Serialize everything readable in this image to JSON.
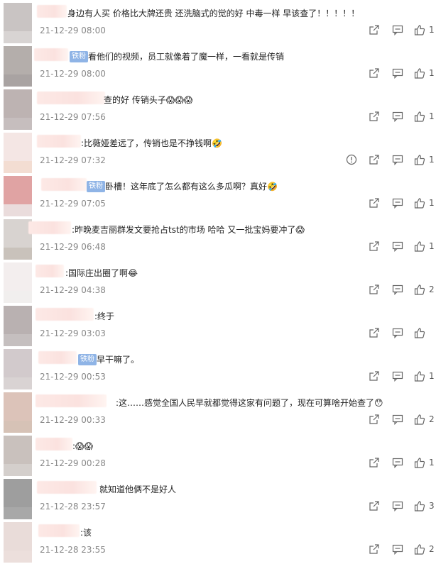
{
  "badge_label": "铁粉",
  "comments": [
    {
      "text": "身边有人买 价格比大牌还贵 还洗脑式的觉的好 中毒一样 早该查了！！！！！",
      "time": "21-12-29 08:00",
      "likes": "1",
      "emoji": ""
    },
    {
      "text": "看他们的视频，员工就像着了魔一样，一看就是传销",
      "time": "21-12-29 08:00",
      "likes": "1",
      "emoji": ""
    },
    {
      "text": "查的好 传销头子",
      "time": "21-12-29 07:56",
      "likes": "1",
      "emoji": "😱😱😱"
    },
    {
      "text": ":比薇娅差远了，传销也是不挣钱啊",
      "time": "21-12-29 07:32",
      "likes": "1",
      "emoji": "🤣"
    },
    {
      "text": "卧槽！这年底了怎么都有这么多瓜啊？真好",
      "time": "21-12-29 07:05",
      "likes": "1",
      "emoji": "🤣"
    },
    {
      "text": ":昨晚麦吉丽群发文要抢占tst的市场 哈哈 又一批宝妈要冲了",
      "time": "21-12-29 06:48",
      "likes": "1",
      "emoji": "😱"
    },
    {
      "text": ":国际庄出圈了啊",
      "time": "21-12-29 04:38",
      "likes": "2",
      "emoji": "😂"
    },
    {
      "text": ":终于",
      "time": "21-12-29 03:03",
      "likes": "",
      "emoji": ""
    },
    {
      "text": "早干嘛了。",
      "time": "21-12-29 00:53",
      "likes": "1",
      "emoji": ""
    },
    {
      "text": ":这……感觉全国人民早就都觉得这家有问题了，现在可算啥开始查了",
      "time": "21-12-29 00:33",
      "likes": "2",
      "emoji": "😯"
    },
    {
      "text": ":",
      "time": "21-12-29 00:28",
      "likes": "1",
      "emoji": "😱😱"
    },
    {
      "text": "就知道他俩不是好人",
      "time": "21-12-28 23:57",
      "likes": "3",
      "emoji": ""
    },
    {
      "text": ":该",
      "time": "21-12-28 23:55",
      "likes": "2",
      "emoji": ""
    }
  ]
}
